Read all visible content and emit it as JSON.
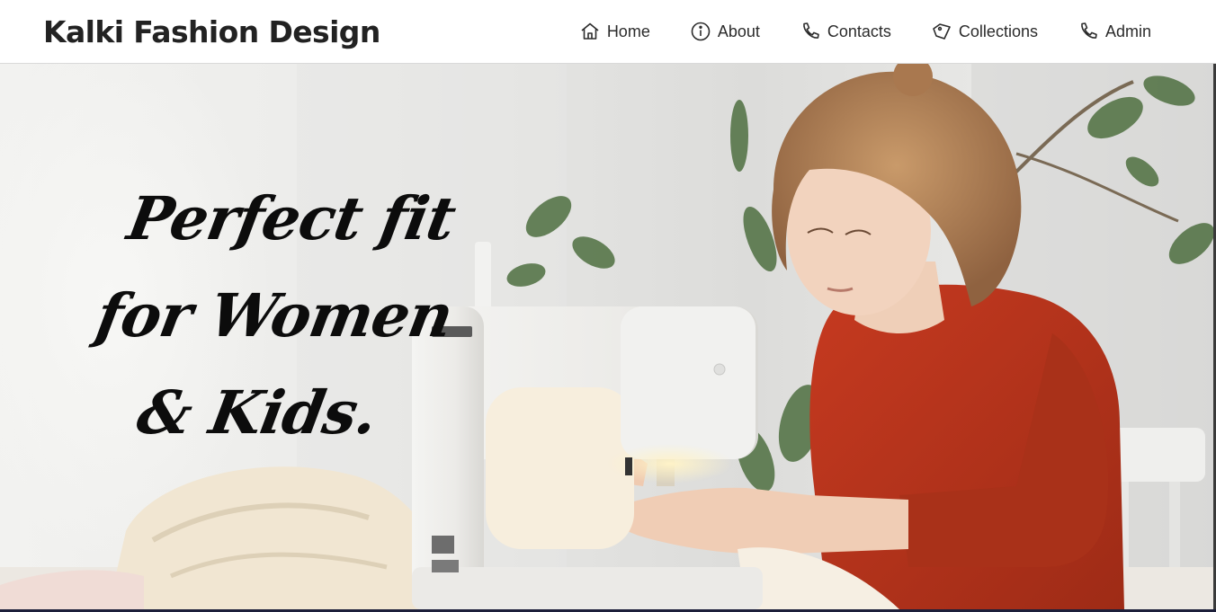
{
  "header": {
    "brand": "Kalki Fashion Design",
    "nav": [
      {
        "label": "Home",
        "icon": "home-icon"
      },
      {
        "label": "About",
        "icon": "info-icon"
      },
      {
        "label": "Contacts",
        "icon": "phone-icon"
      },
      {
        "label": "Collections",
        "icon": "tag-icon"
      },
      {
        "label": "Admin",
        "icon": "phone-icon"
      }
    ]
  },
  "hero": {
    "tagline": "Perfect fit for Women & Kids.",
    "image": "woman-sewing-photo"
  },
  "colors": {
    "text": "#222222",
    "nav_text": "#2b2b2b",
    "tagline": "#0c0c0c",
    "shirt": "#b8321c",
    "bottom_strip": "#1c1f3a"
  }
}
